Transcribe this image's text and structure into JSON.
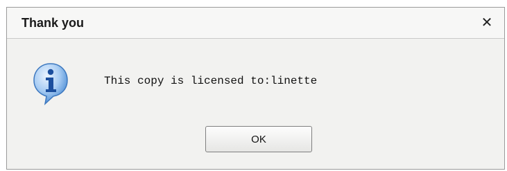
{
  "dialog": {
    "title": "Thank you",
    "close_glyph": "✕",
    "message": "This copy is licensed to:linette",
    "icon": "info-icon",
    "ok_label": "OK"
  }
}
